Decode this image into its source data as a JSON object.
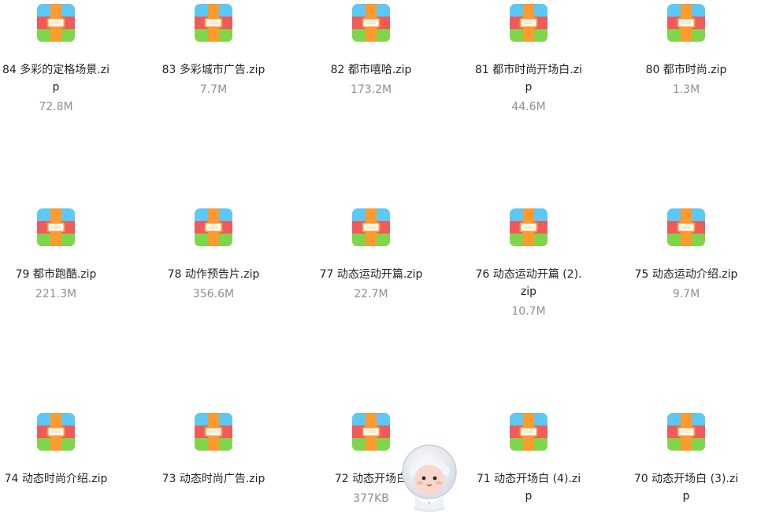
{
  "files": [
    {
      "name": "84 多彩的定格场景.zip",
      "size": "72.8M",
      "icon": "archive-zip-icon"
    },
    {
      "name": "83 多彩城市广告.zip",
      "size": "7.7M",
      "icon": "archive-zip-icon"
    },
    {
      "name": "82 都市嘻哈.zip",
      "size": "173.2M",
      "icon": "archive-zip-icon"
    },
    {
      "name": "81 都市时尚开场白.zip",
      "size": "44.6M",
      "icon": "archive-zip-icon"
    },
    {
      "name": "80 都市时尚.zip",
      "size": "1.3M",
      "icon": "archive-zip-icon"
    },
    {
      "name": "79 都市跑酷.zip",
      "size": "221.3M",
      "icon": "archive-zip-icon"
    },
    {
      "name": "78 动作预告片.zip",
      "size": "356.6M",
      "icon": "archive-zip-icon"
    },
    {
      "name": "77 动态运动开篇.zip",
      "size": "22.7M",
      "icon": "archive-zip-icon"
    },
    {
      "name": "76 动态运动开篇 (2).zip",
      "size": "10.7M",
      "icon": "archive-zip-icon"
    },
    {
      "name": "75 动态运动介绍.zip",
      "size": "9.7M",
      "icon": "archive-zip-icon"
    },
    {
      "name": "74 动态时尚介绍.zip",
      "size": "",
      "icon": "archive-zip-icon"
    },
    {
      "name": "73 动态时尚广告.zip",
      "size": "",
      "icon": "archive-zip-icon"
    },
    {
      "name": "72 动态开场白",
      "size": "377KB",
      "icon": "archive-zip-icon"
    },
    {
      "name": "71 动态开场白 (4).zip",
      "size": "",
      "icon": "archive-zip-icon"
    },
    {
      "name": "70 动态开场白 (3).zip",
      "size": "",
      "icon": "archive-zip-icon"
    }
  ],
  "mascot": {
    "icon": "astronaut-mascot-icon"
  },
  "colors": {
    "icon_top": "#5cc8f5",
    "icon_middle": "#ef5b5b",
    "icon_bottom": "#7fd64a",
    "icon_strap": "#ff9a2e",
    "name_text": "#1f2329",
    "size_text": "#8a8f99"
  }
}
